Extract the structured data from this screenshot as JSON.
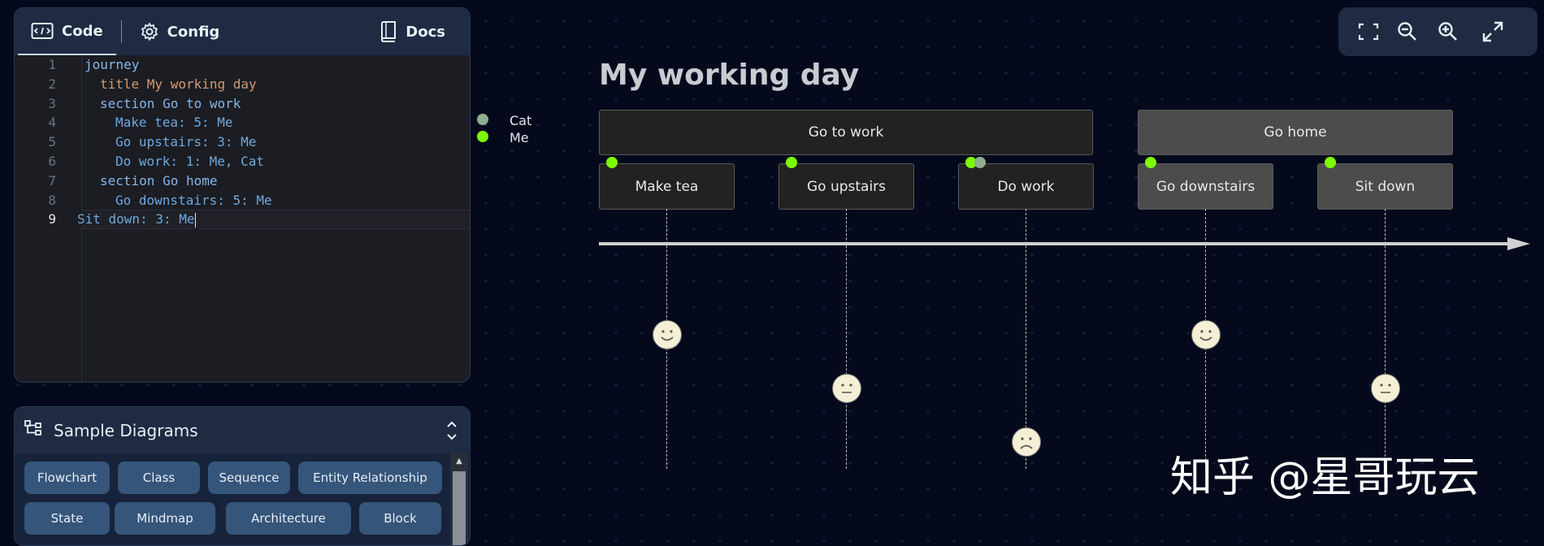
{
  "editor": {
    "tabs": {
      "code": "Code",
      "config": "Config",
      "docs": "Docs"
    },
    "lines": [
      {
        "n": "1",
        "text": "journey"
      },
      {
        "n": "2",
        "text": "title My working day"
      },
      {
        "n": "3",
        "text": "section Go to work"
      },
      {
        "n": "4",
        "text": "Make tea: 5: Me"
      },
      {
        "n": "5",
        "text": "Go upstairs: 3: Me"
      },
      {
        "n": "6",
        "text": "Do work: 1: Me, Cat"
      },
      {
        "n": "7",
        "text": "section Go home"
      },
      {
        "n": "8",
        "text": "Go downstairs: 5: Me"
      },
      {
        "n": "9",
        "text": "Sit down: 3: Me"
      }
    ]
  },
  "samples": {
    "title": "Sample Diagrams",
    "buttons": [
      "Flowchart",
      "Class",
      "Sequence",
      "Entity Relationship",
      "State",
      "Mindmap",
      "Architecture",
      "Block"
    ]
  },
  "toolbar": {
    "icons": [
      "fit-screen-icon",
      "zoom-out-icon",
      "zoom-in-icon",
      "expand-icon"
    ]
  },
  "diagram": {
    "title": "My working day",
    "legend": [
      {
        "name": "Cat",
        "color": "#8fae8f"
      },
      {
        "name": "Me",
        "color": "#7cfc00"
      }
    ],
    "sections": [
      {
        "name": "Go to work",
        "color": "#222222"
      },
      {
        "name": "Go home",
        "color": "#4c4c4c"
      }
    ],
    "tasks": [
      {
        "name": "Make tea",
        "score": 5,
        "actors": [
          "Me"
        ],
        "section": "Go to work"
      },
      {
        "name": "Go upstairs",
        "score": 3,
        "actors": [
          "Me"
        ],
        "section": "Go to work"
      },
      {
        "name": "Do work",
        "score": 1,
        "actors": [
          "Me",
          "Cat"
        ],
        "section": "Go to work"
      },
      {
        "name": "Go downstairs",
        "score": 5,
        "actors": [
          "Me"
        ],
        "section": "Go home"
      },
      {
        "name": "Sit down",
        "score": 3,
        "actors": [
          "Me"
        ],
        "section": "Go home"
      }
    ]
  },
  "watermark": "知乎 @星哥玩云"
}
